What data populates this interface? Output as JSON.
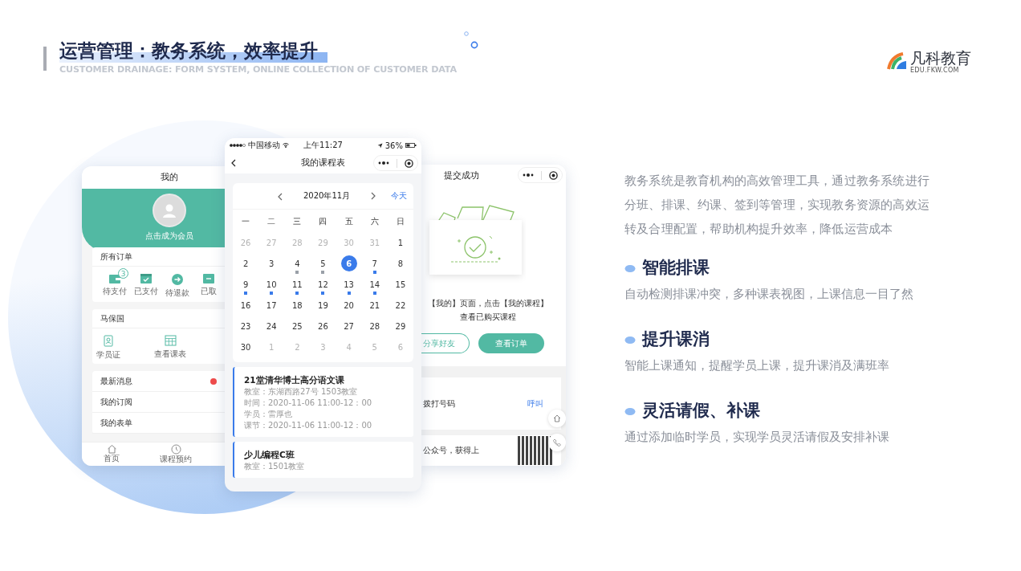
{
  "header": {
    "title": "运营管理：教务系统，效率提升",
    "subtitle": "CUSTOMER DRAINAGE: FORM SYSTEM, ONLINE COLLECTION OF CUSTOMER DATA"
  },
  "logo": {
    "name": "凡科教育",
    "domain": "EDU.FKW.COM"
  },
  "profile_phone": {
    "title": "我的",
    "member_prompt": "点击成为会员",
    "orders": {
      "title": "所有订单",
      "items": [
        {
          "label": "待支付",
          "kind": "wallet",
          "badge": "3"
        },
        {
          "label": "已支付",
          "kind": "paid"
        },
        {
          "label": "待退款",
          "kind": "refund"
        },
        {
          "label": "已取",
          "kind": "cancel"
        }
      ]
    },
    "student": {
      "name": "马保国",
      "tools": [
        {
          "label": "学员证",
          "kind": "card"
        },
        {
          "label": "查看课表",
          "kind": "table"
        }
      ]
    },
    "menu": [
      {
        "label": "最新消息",
        "unread": true
      },
      {
        "label": "我的订阅",
        "unread": false
      },
      {
        "label": "我的表单",
        "unread": false
      }
    ],
    "tabbar": [
      {
        "label": "首页",
        "kind": "home"
      },
      {
        "label": "课程预约",
        "kind": "clock"
      }
    ]
  },
  "schedule_phone": {
    "status_bar": {
      "carrier": "中国移动",
      "time": "上午11:27",
      "battery": "36%"
    },
    "title": "我的课程表",
    "calendar": {
      "month": "2020年11月",
      "today_link": "今天",
      "weekdays": [
        "一",
        "二",
        "三",
        "四",
        "五",
        "六",
        "日"
      ],
      "days": [
        {
          "label": "26",
          "in_month": false,
          "selected": false
        },
        {
          "label": "27",
          "in_month": false,
          "selected": false
        },
        {
          "label": "28",
          "in_month": false,
          "selected": false
        },
        {
          "label": "29",
          "in_month": false,
          "selected": false
        },
        {
          "label": "30",
          "in_month": false,
          "selected": false
        },
        {
          "label": "31",
          "in_month": false,
          "selected": false
        },
        {
          "label": "1",
          "in_month": true,
          "selected": false
        },
        {
          "label": "2",
          "in_month": true,
          "selected": false
        },
        {
          "label": "3",
          "in_month": true,
          "selected": false
        },
        {
          "label": "4",
          "in_month": true,
          "selected": false,
          "color": "#9aa0a8"
        },
        {
          "label": "5",
          "in_month": true,
          "selected": false,
          "color": "#9aa0a8"
        },
        {
          "label": "6",
          "in_month": true,
          "selected": true
        },
        {
          "label": "7",
          "in_month": true,
          "selected": false,
          "color": "#3a7bea"
        },
        {
          "label": "8",
          "in_month": true,
          "selected": false
        },
        {
          "label": "9",
          "in_month": true,
          "selected": false,
          "color": "#3a7bea"
        },
        {
          "label": "10",
          "in_month": true,
          "selected": false,
          "color": "#3a7bea"
        },
        {
          "label": "11",
          "in_month": true,
          "selected": false,
          "color": "#3a7bea"
        },
        {
          "label": "12",
          "in_month": true,
          "selected": false,
          "color": "#3a7bea"
        },
        {
          "label": "13",
          "in_month": true,
          "selected": false,
          "color": "#3a7bea"
        },
        {
          "label": "14",
          "in_month": true,
          "selected": false,
          "color": "#3a7bea"
        },
        {
          "label": "15",
          "in_month": true,
          "selected": false
        },
        {
          "label": "16",
          "in_month": true,
          "selected": false
        },
        {
          "label": "17",
          "in_month": true,
          "selected": false
        },
        {
          "label": "18",
          "in_month": true,
          "selected": false
        },
        {
          "label": "19",
          "in_month": true,
          "selected": false
        },
        {
          "label": "20",
          "in_month": true,
          "selected": false
        },
        {
          "label": "21",
          "in_month": true,
          "selected": false
        },
        {
          "label": "22",
          "in_month": true,
          "selected": false
        },
        {
          "label": "23",
          "in_month": true,
          "selected": false
        },
        {
          "label": "24",
          "in_month": true,
          "selected": false
        },
        {
          "label": "25",
          "in_month": true,
          "selected": false
        },
        {
          "label": "26",
          "in_month": true,
          "selected": false
        },
        {
          "label": "27",
          "in_month": true,
          "selected": false
        },
        {
          "label": "28",
          "in_month": true,
          "selected": false
        },
        {
          "label": "29",
          "in_month": true,
          "selected": false
        },
        {
          "label": "30",
          "in_month": true,
          "selected": false
        },
        {
          "label": "1",
          "in_month": false,
          "selected": false
        },
        {
          "label": "2",
          "in_month": false,
          "selected": false
        },
        {
          "label": "3",
          "in_month": false,
          "selected": false
        },
        {
          "label": "4",
          "in_month": false,
          "selected": false
        },
        {
          "label": "5",
          "in_month": false,
          "selected": false
        },
        {
          "label": "6",
          "in_month": false,
          "selected": false
        }
      ]
    },
    "courses": [
      {
        "title": "21堂清华博士高分语文课",
        "lines": [
          "教室：东湖西路27号 1503教室",
          "时间：2020-11-06 11:00-12：00",
          "学员：雷厚也",
          "课节：2020-11-06 11:00-12：00"
        ]
      },
      {
        "title": "少儿编程C班",
        "lines": [
          "教室：1501教室"
        ]
      }
    ]
  },
  "confirm_phone": {
    "title": "提交成功",
    "message": [
      "【我的】页面，点击【我的课程】",
      "查看已购买课程"
    ],
    "buttons": [
      {
        "label": "分享好友",
        "kind": "outline"
      },
      {
        "label": "查看订单",
        "kind": "filled"
      }
    ],
    "call": {
      "label": "拨打号码",
      "action": "呼叫"
    },
    "follow": {
      "text": "公众号，获得上"
    }
  },
  "intro": "教务系统是教育机构的高效管理工具，通过教务系统进行分班、排课、约课、签到等管理，实现教务资源的高效运转及合理配置，帮助机构提升效率，降低运营成本",
  "features": [
    {
      "title": "智能排课",
      "text": "自动检测排课冲突，多种课表视图，上课信息一目了然"
    },
    {
      "title": "提升课消",
      "text": "智能上课通知，提醒学员上课，提升课消及满班率"
    },
    {
      "title": "灵活请假、补课",
      "text": "通过添加临时学员，实现学员灵活请假及安排补课"
    }
  ]
}
